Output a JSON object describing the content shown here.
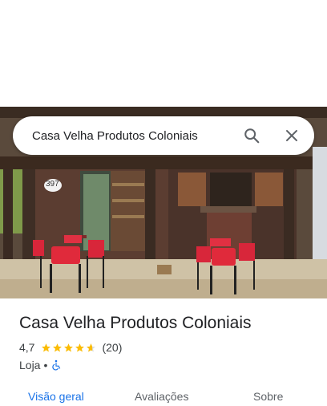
{
  "search": {
    "query": "Casa Velha Produtos Coloniais"
  },
  "icons": {
    "search": "search-icon",
    "close": "close-icon",
    "accessibility": "wheelchair-icon",
    "star": "star-icon"
  },
  "photo": {
    "house_number": "397"
  },
  "place": {
    "title": "Casa Velha Produtos Coloniais",
    "rating": "4,7",
    "rating_value": 4.7,
    "review_count": "(20)",
    "category": "Loja",
    "separator": "•"
  },
  "tabs": [
    {
      "label": "Visão geral",
      "active": true
    },
    {
      "label": "Avaliações",
      "active": false
    },
    {
      "label": "Sobre",
      "active": false
    }
  ],
  "colors": {
    "accent": "#1a73e8",
    "star": "#fbbc04",
    "chair_red": "#e02a3b"
  }
}
